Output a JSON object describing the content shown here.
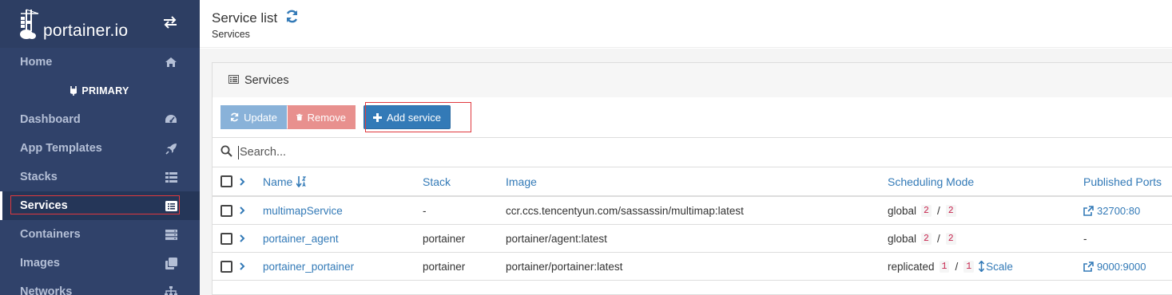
{
  "sidebar": {
    "brand": "portainer.io",
    "endpoint_label": "PRIMARY",
    "home": "Home",
    "items": [
      {
        "label": "Dashboard",
        "icon": "tachometer-icon"
      },
      {
        "label": "App Templates",
        "icon": "rocket-icon"
      },
      {
        "label": "Stacks",
        "icon": "th-list-icon"
      },
      {
        "label": "Services",
        "icon": "list-alt-icon",
        "active": true
      },
      {
        "label": "Containers",
        "icon": "server-icon"
      },
      {
        "label": "Images",
        "icon": "clone-icon"
      },
      {
        "label": "Networks",
        "icon": "sitemap-icon"
      }
    ]
  },
  "header": {
    "title": "Service list",
    "breadcrumb": "Services"
  },
  "widget": {
    "title": "Services",
    "buttons": {
      "update": "Update",
      "remove": "Remove",
      "add": "Add service"
    },
    "search": {
      "placeholder": "Search...",
      "value": ""
    },
    "columns": {
      "name": "Name",
      "stack": "Stack",
      "image": "Image",
      "mode": "Scheduling Mode",
      "ports": "Published Ports"
    },
    "rows": [
      {
        "name": "multimapService",
        "stack": "-",
        "image": "ccr.ccs.tencentyun.com/sassassin/multimap:latest",
        "mode": "global",
        "running": "2",
        "sep": "/",
        "desired": "2",
        "ports": "32700:80",
        "scale": ""
      },
      {
        "name": "portainer_agent",
        "stack": "portainer",
        "image": "portainer/agent:latest",
        "mode": "global",
        "running": "2",
        "sep": "/",
        "desired": "2",
        "ports": "-",
        "scale": ""
      },
      {
        "name": "portainer_portainer",
        "stack": "portainer",
        "image": "portainer/portainer:latest",
        "mode": "replicated",
        "running": "1",
        "sep": "/",
        "desired": "1",
        "ports": "9000:9000",
        "scale": "Scale"
      }
    ]
  },
  "colors": {
    "sidebar_bg": "#30426a",
    "accent": "#337ab7",
    "update_btn": "#89b2d9",
    "remove_btn": "#e8908e",
    "highlight_border": "#e0393e",
    "count_text": "#c7254e"
  }
}
